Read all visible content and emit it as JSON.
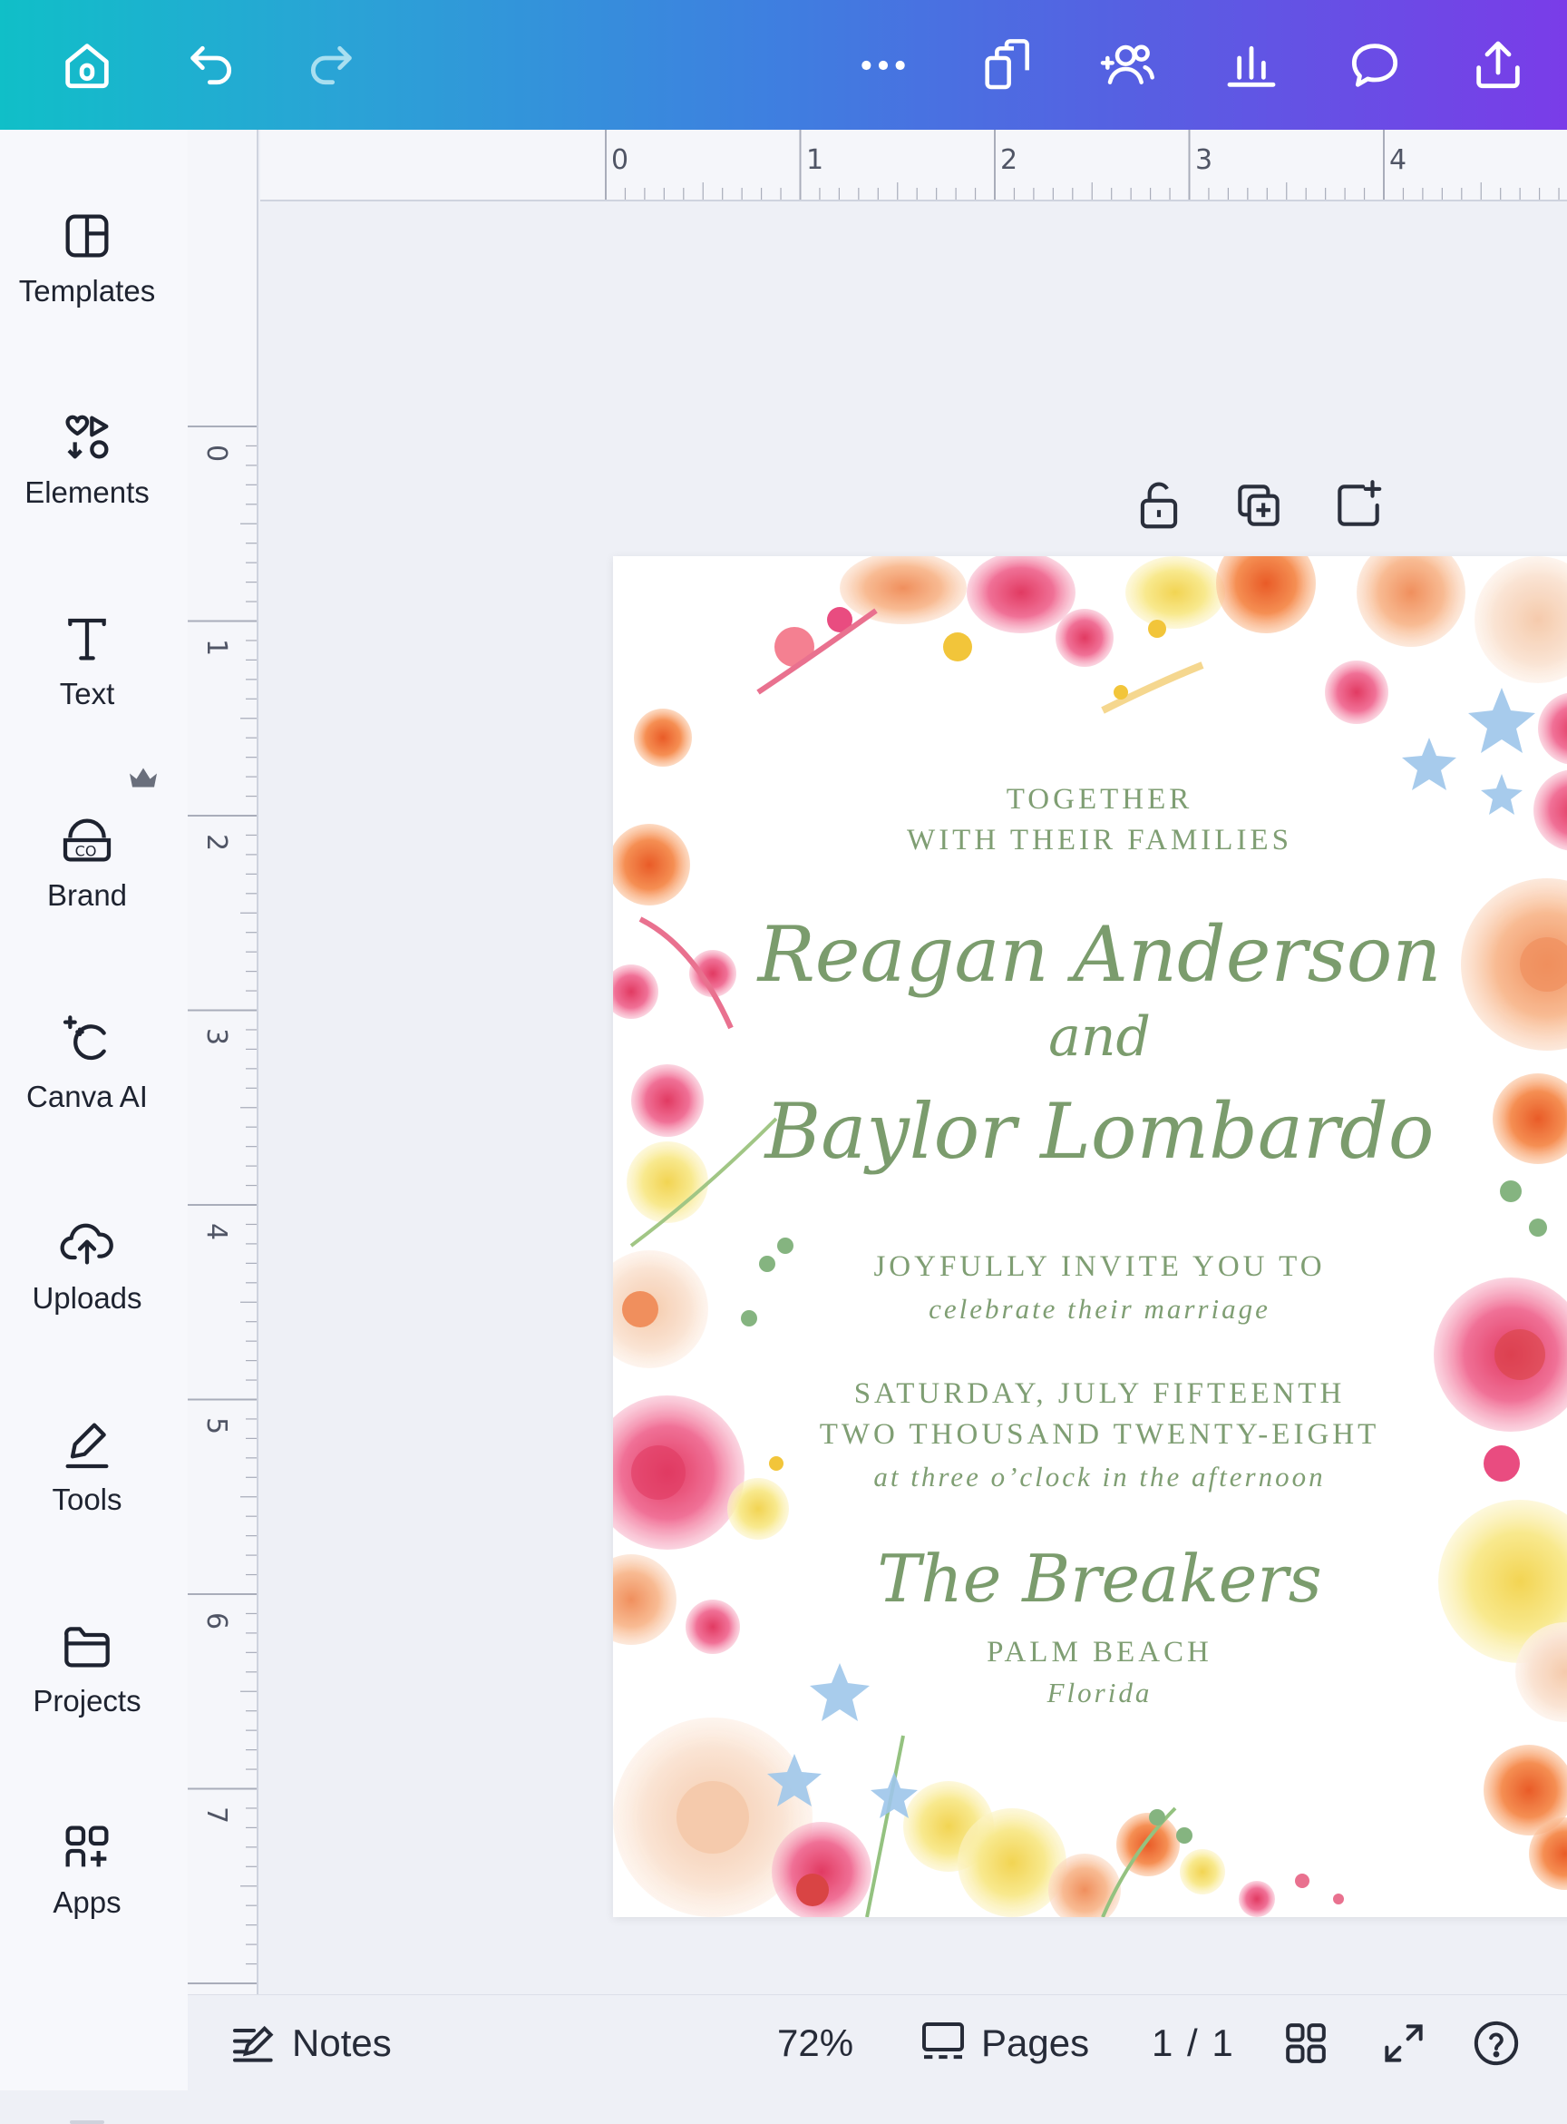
{
  "colors": {
    "topbar_start": "#10bfc8",
    "topbar_end": "#7a3ce8",
    "invite_text": "#7f9e73",
    "canvas_bg": "#eef0f6"
  },
  "topbar": {
    "icons": [
      "home-icon",
      "undo-icon",
      "redo-icon",
      "more-icon",
      "duplicate-icon",
      "share-people-icon",
      "insights-icon",
      "comment-icon",
      "upload-share-icon"
    ]
  },
  "sidebar": {
    "items": [
      {
        "label": "Templates",
        "icon": "templates-icon"
      },
      {
        "label": "Elements",
        "icon": "elements-icon"
      },
      {
        "label": "Text",
        "icon": "text-icon"
      },
      {
        "label": "Brand",
        "icon": "brand-icon"
      },
      {
        "label": "Canva AI",
        "icon": "canva-ai-icon"
      },
      {
        "label": "Uploads",
        "icon": "uploads-icon"
      },
      {
        "label": "Tools",
        "icon": "tools-icon"
      },
      {
        "label": "Projects",
        "icon": "projects-icon"
      },
      {
        "label": "Apps",
        "icon": "apps-icon"
      }
    ]
  },
  "rulers": {
    "top": [
      "0",
      "1",
      "2",
      "3",
      "4"
    ],
    "left": [
      "0",
      "1",
      "2",
      "3",
      "4",
      "5",
      "6",
      "7"
    ]
  },
  "invitation": {
    "line1": "TOGETHER",
    "line2": "WITH THEIR FAMILIES",
    "name1": "Reagan Anderson",
    "and": "and",
    "name2": "Baylor Lombardo",
    "invite_line": "JOYFULLY INVITE YOU TO",
    "celebrate": "celebrate their marriage",
    "date1": "SATURDAY, JULY FIFTEENTH",
    "date2": "TWO THOUSAND TWENTY-EIGHT",
    "time": "at three o’clock in the afternoon",
    "venue": "The Breakers",
    "city": "PALM BEACH",
    "state": "Florida"
  },
  "bottombar": {
    "notes": "Notes",
    "zoom": "72%",
    "pages": "Pages",
    "page_count": "1 / 1"
  }
}
